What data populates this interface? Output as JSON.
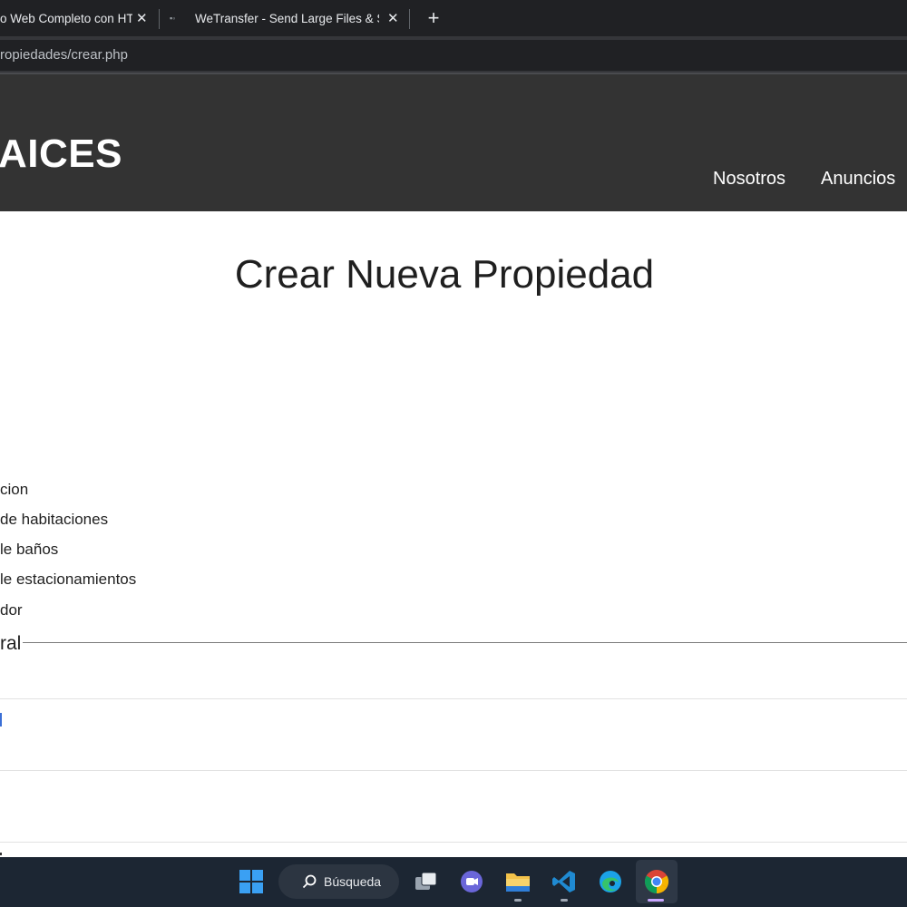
{
  "browser": {
    "tabs": [
      {
        "title": "o Web Completo con HTML"
      },
      {
        "title": "WeTransfer - Send Large Files & Share"
      }
    ],
    "close_glyph": "✕",
    "new_tab_glyph": "+",
    "url": "ropiedades/crear.php"
  },
  "site": {
    "logo": "AICES",
    "nav": [
      "Nosotros",
      "Anuncios"
    ]
  },
  "page": {
    "title": "Crear Nueva Propiedad",
    "fields": [
      "cion",
      "de habitaciones",
      "le baños",
      "le estacionamientos",
      "dor"
    ],
    "legend": "ral"
  },
  "taskbar": {
    "search_label": "Búsqueda",
    "apps": [
      "start-icon",
      "search-icon",
      "task-view-icon",
      "meet-icon",
      "file-explorer-icon",
      "vscode-icon",
      "edge-icon",
      "chrome-icon"
    ],
    "colors": {
      "start": "#3aa0f3",
      "vscode": "#1f8ad2",
      "edge": "#1ba3e8",
      "explorer": "#f3c24a"
    }
  }
}
